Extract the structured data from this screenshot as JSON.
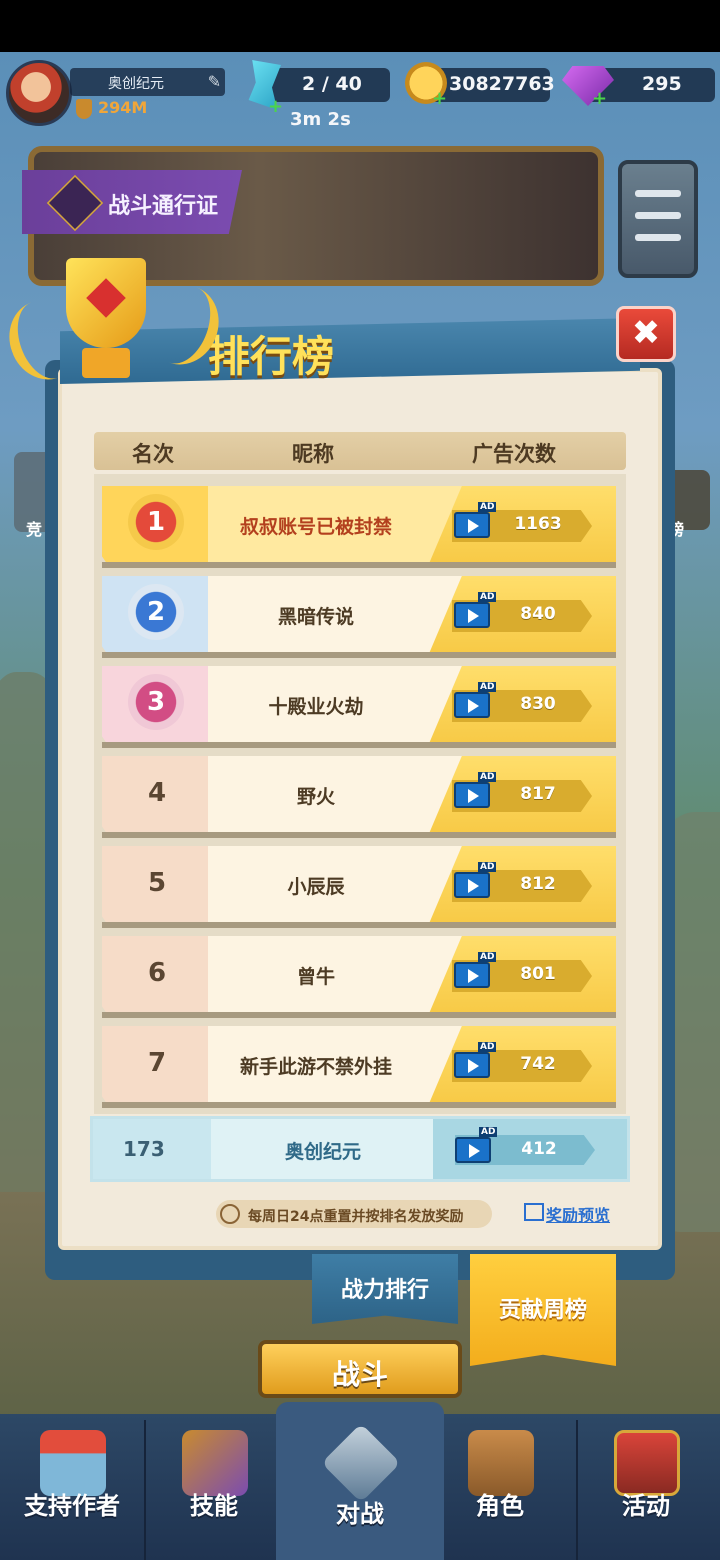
{
  "status": {
    "player_name": "奥创纪元",
    "power": "294M",
    "energy": "2 / 40",
    "energy_timer": "3m 2s",
    "coins": "30827763",
    "gems": "295"
  },
  "banner": {
    "pass_label": "战斗通行证"
  },
  "side": {
    "left_label": "竞",
    "right_label": "榜"
  },
  "leaderboard": {
    "title": "排行榜",
    "columns": {
      "rank": "名次",
      "nickname": "昵称",
      "ad_count": "广告次数"
    },
    "ad_tag": "AD",
    "rows": [
      {
        "rank": "1",
        "nickname": "叔叔账号已被封禁",
        "count": "1163"
      },
      {
        "rank": "2",
        "nickname": "黑暗传说",
        "count": "840"
      },
      {
        "rank": "3",
        "nickname": "十殿业火劫",
        "count": "830"
      },
      {
        "rank": "4",
        "nickname": "野火",
        "count": "817"
      },
      {
        "rank": "5",
        "nickname": "小辰辰",
        "count": "812"
      },
      {
        "rank": "6",
        "nickname": "曾牛",
        "count": "801"
      },
      {
        "rank": "7",
        "nickname": "新手此游不禁外挂",
        "count": "742"
      }
    ],
    "self_row": {
      "rank": "173",
      "nickname": "奥创纪元",
      "count": "412"
    },
    "reset_note": "每周日24点重置并按排名发放奖励",
    "preview_link": "奖励预览",
    "close_glyph": "✖"
  },
  "tabs": {
    "power_rank": "战力排行",
    "weekly_contrib": "贡献周榜"
  },
  "fight_button": "战斗",
  "nav": {
    "items": [
      {
        "label": "支持作者"
      },
      {
        "label": "技能"
      },
      {
        "label": "对战"
      },
      {
        "label": "角色"
      },
      {
        "label": "活动"
      }
    ]
  },
  "colors": {
    "accent_gold": "#ffde6b",
    "title_yellow": "#ffe15a",
    "link_blue": "#2a6fd0",
    "close_red": "#d63a2e"
  }
}
